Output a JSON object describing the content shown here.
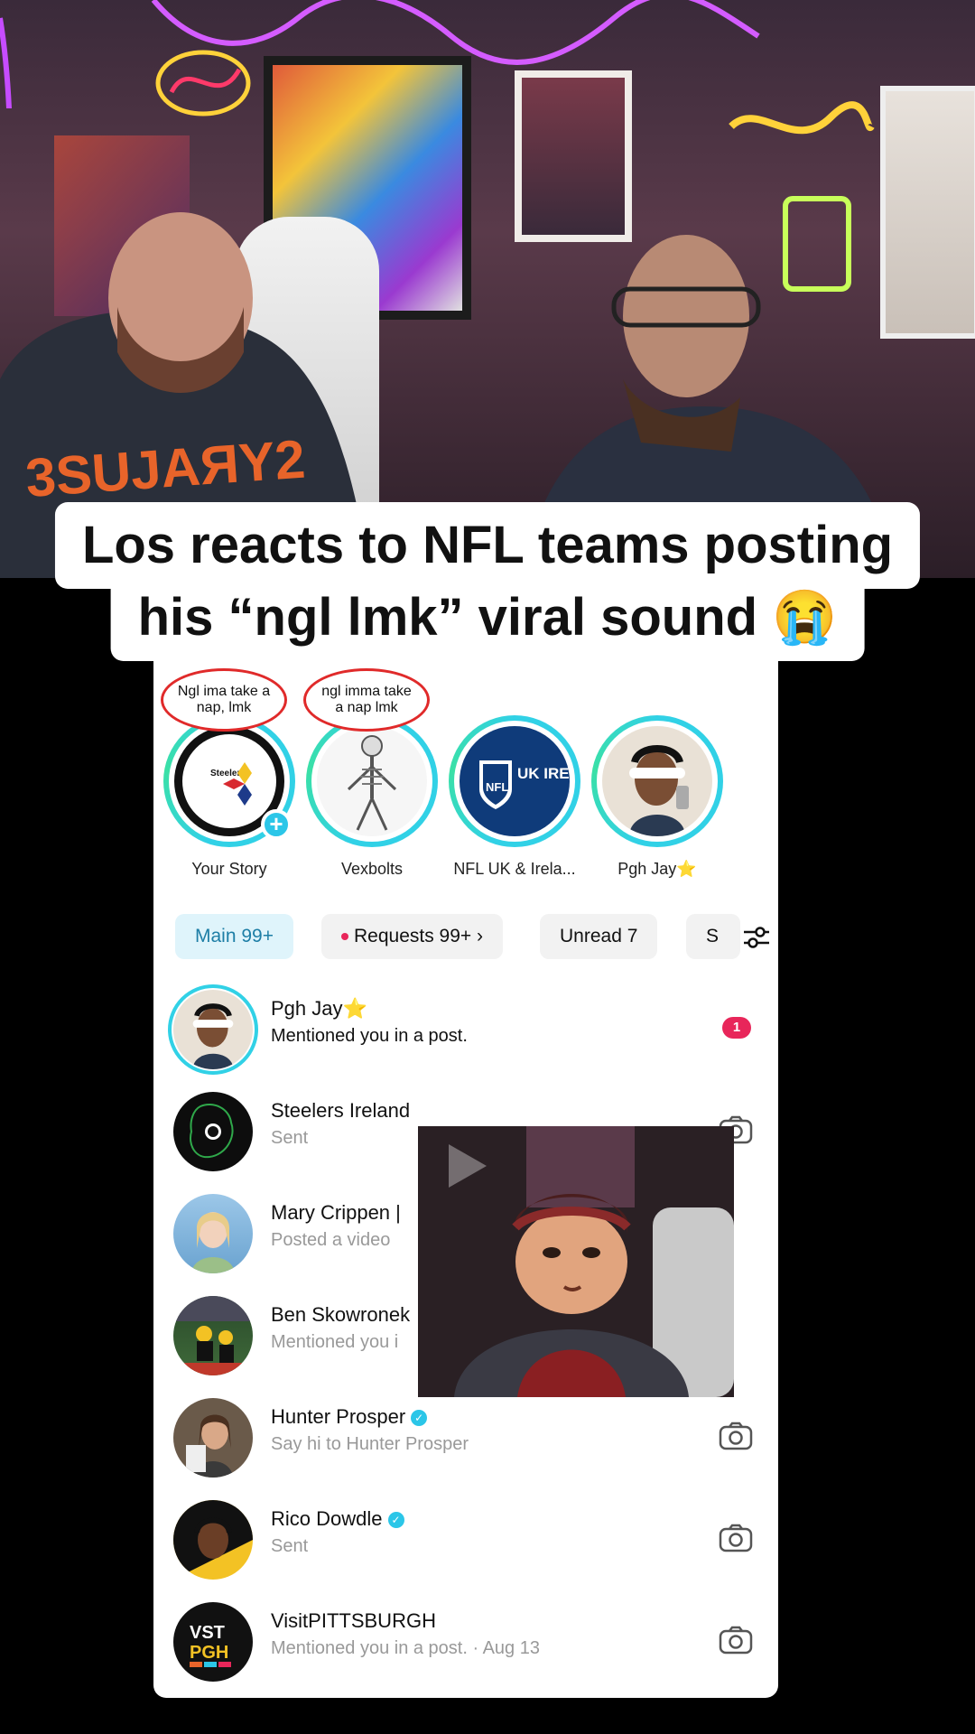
{
  "caption": {
    "line1": "Los reacts to NFL teams posting",
    "line2": "his “ngl lmk” viral sound 😭"
  },
  "stories": [
    {
      "label": "Your Story",
      "bubble": "Ngl ima take a nap, lmk",
      "avatar_text": "Steelers"
    },
    {
      "label": "Vexbolts",
      "bubble": "ngl imma take a nap lmk"
    },
    {
      "label": "NFL UK & Irela...",
      "avatar_text": "UK IRE"
    },
    {
      "label": "Pgh Jay⭐"
    }
  ],
  "filters": [
    {
      "label": "Main 99+"
    },
    {
      "label": "Requests 99+ ›"
    },
    {
      "label": "Unread 7"
    },
    {
      "label": "S"
    }
  ],
  "conversations": [
    {
      "name": "Pgh Jay⭐",
      "sub": "Mentioned you in a post.",
      "badge": "1"
    },
    {
      "name": "Steelers Ireland",
      "sub": "Sent"
    },
    {
      "name": "Mary Crippen |",
      "sub": "Posted a video"
    },
    {
      "name": "Ben Skowronek",
      "sub": "Mentioned you i"
    },
    {
      "name": "Hunter Prosper",
      "sub": "Say hi to Hunter Prosper"
    },
    {
      "name": "Rico Dowdle",
      "sub": "Sent"
    },
    {
      "name": "VisitPITTSBURGH",
      "sub": "Mentioned you in a post. · Aug 13",
      "avatar_text": "VST PGH"
    }
  ],
  "colors": {
    "accent": "#31d1e6",
    "badge": "#e8265a",
    "caption_bg": "#ffffff"
  },
  "icons": [
    "filter-icon",
    "camera-icon",
    "verified-icon",
    "play-icon",
    "add-story-icon"
  ]
}
